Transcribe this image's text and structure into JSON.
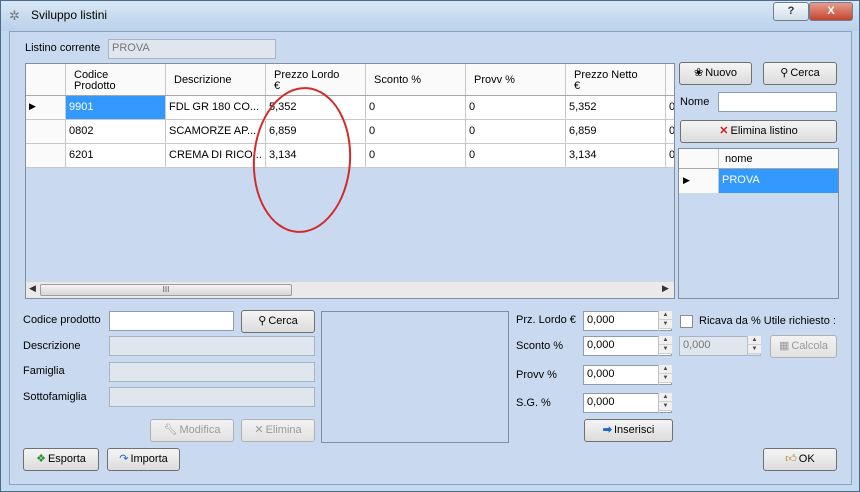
{
  "window": {
    "title": "Sviluppo listini",
    "help": "?",
    "close": "X"
  },
  "header": {
    "listino_label": "Listino corrente",
    "listino_value": "PROVA"
  },
  "grid": {
    "columns": [
      "Codice\nProdotto",
      "Descrizione",
      "Prezzo Lordo\n€",
      "Sconto %",
      "Provv %",
      "Prezzo Netto\n€"
    ],
    "rows": [
      [
        "9901",
        "FDL GR 180 CO...",
        "5,352",
        "0",
        "0",
        "5,352",
        "0"
      ],
      [
        "0802",
        "SCAMORZE AP...",
        "6,859",
        "0",
        "0",
        "6,859",
        "0"
      ],
      [
        "6201",
        "CREMA DI RICO...",
        "3,134",
        "0",
        "0",
        "3,134",
        "0"
      ]
    ],
    "scroll_grip": "III"
  },
  "right": {
    "nuovo": "Nuovo",
    "cerca": "Cerca",
    "nome_label": "Nome",
    "nome_value": "",
    "elimina_listino": "Elimina listino",
    "list_header": "nome",
    "list_items": [
      "PROVA"
    ]
  },
  "product": {
    "codice_label": "Codice prodotto",
    "codice_value": "",
    "cerca": "Cerca",
    "descrizione_label": "Descrizione",
    "famiglia_label": "Famiglia",
    "sottofamiglia_label": "Sottofamiglia",
    "modifica": "Modifica",
    "elimina": "Elimina"
  },
  "pricing": {
    "prz_lordo_label": "Prz. Lordo €",
    "prz_lordo_value": "0,000",
    "sconto_label": "Sconto %",
    "sconto_value": "0,000",
    "provv_label": "Provv %",
    "provv_value": "0,000",
    "sg_label": "S.G. %",
    "sg_value": "0,000",
    "inserisci": "Inserisci",
    "ricava_label": "Ricava da % Utile richiesto :",
    "ricava_value": "0,000",
    "calcola": "Calcola"
  },
  "footer": {
    "esporta": "Esporta",
    "importa": "Importa",
    "ok": "OK"
  },
  "colors": {
    "selection": "#3399ff",
    "annotation": "#d12b2b",
    "panel": "#c9daf0"
  }
}
